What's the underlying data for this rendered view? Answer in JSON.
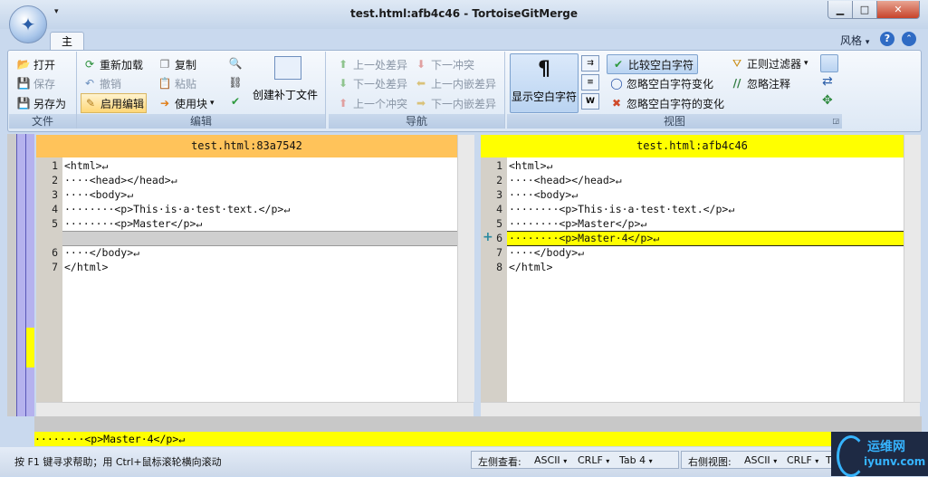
{
  "window": {
    "title": "test.html:afb4c46 - TortoiseGitMerge",
    "qat_arrow": "▾",
    "minimize": "▁",
    "maximize": "□",
    "close": "✕"
  },
  "ribbon_tabs": {
    "main": "主",
    "style_menu": "风格",
    "style_arrow": "▾",
    "help": "?",
    "minimize_ribbon": "⌃"
  },
  "groups": {
    "file": {
      "label": "文件",
      "open": "打开",
      "save": "保存",
      "save_as": "另存为"
    },
    "edit": {
      "label": "编辑",
      "reload": "重新加载",
      "undo": "撤销",
      "enable_edit": "启用编辑",
      "copy": "复制",
      "paste": "粘贴",
      "use_block": "使用块",
      "create_patch": "创建补丁文件"
    },
    "nav": {
      "label": "导航",
      "prev_diff": "上一处差异",
      "next_conflict": "下一冲突",
      "next_diff": "下一处差异",
      "prev_inline_diff": "上一内嵌差异",
      "prev_conflict": "上一个冲突",
      "next_inline_diff": "下一内嵌差异"
    },
    "view": {
      "label": "视图",
      "show_whitespace": "显示空白字符",
      "compare_whitespace": "比较空白字符",
      "ignore_whitespace_change": "忽略空白字符变化",
      "ignore_whitespace_changes": "忽略空白字符的变化",
      "regex_filter": "正则过滤器",
      "ignore_comments": "忽略注释"
    }
  },
  "left_pane": {
    "header": "test.html:83a7542",
    "lines": [
      {
        "n": "1",
        "text": "<html>↵"
      },
      {
        "n": "2",
        "text": "····<head></head>↵"
      },
      {
        "n": "3",
        "text": "····<body>↵"
      },
      {
        "n": "4",
        "text": "········<p>This·is·a·test·text.</p>↵"
      },
      {
        "n": "5",
        "text": "········<p>Master</p>↵"
      },
      {
        "n": "6",
        "text": "····</body>↵"
      },
      {
        "n": "7",
        "text": "</html>"
      }
    ]
  },
  "right_pane": {
    "header": "test.html:afb4c46",
    "added_marker": "+",
    "lines": [
      {
        "n": "1",
        "text": "<html>↵"
      },
      {
        "n": "2",
        "text": "····<head></head>↵"
      },
      {
        "n": "3",
        "text": "····<body>↵"
      },
      {
        "n": "4",
        "text": "········<p>This·is·a·test·text.</p>↵"
      },
      {
        "n": "5",
        "text": "········<p>Master</p>↵"
      },
      {
        "n": "6",
        "text": "········<p>Master·4</p>↵"
      },
      {
        "n": "7",
        "text": "····</body>↵"
      },
      {
        "n": "8",
        "text": "</html>"
      }
    ]
  },
  "line_diff": "········<p>Master·4</p>↵",
  "status": {
    "help": "按 F1 键寻求帮助；用 Ctrl+鼠标滚轮横向滚动",
    "left_view": "左侧查看:",
    "left_enc": "ASCII",
    "left_eol": "CRLF",
    "left_tab": "Tab 4",
    "right_view": "右侧视图:",
    "right_enc": "ASCII",
    "right_eol": "CRLF",
    "right_tab": "T",
    "dropdown": "▾"
  },
  "watermark": {
    "text1": "运维网",
    "text2": "iyunv.com"
  },
  "colors": {
    "left_header": "#ffc35a",
    "right_header": "#ffff00",
    "added_line": "#ffff00",
    "removed_block": "#cfcfcf",
    "strip": "#b5b2ee"
  }
}
